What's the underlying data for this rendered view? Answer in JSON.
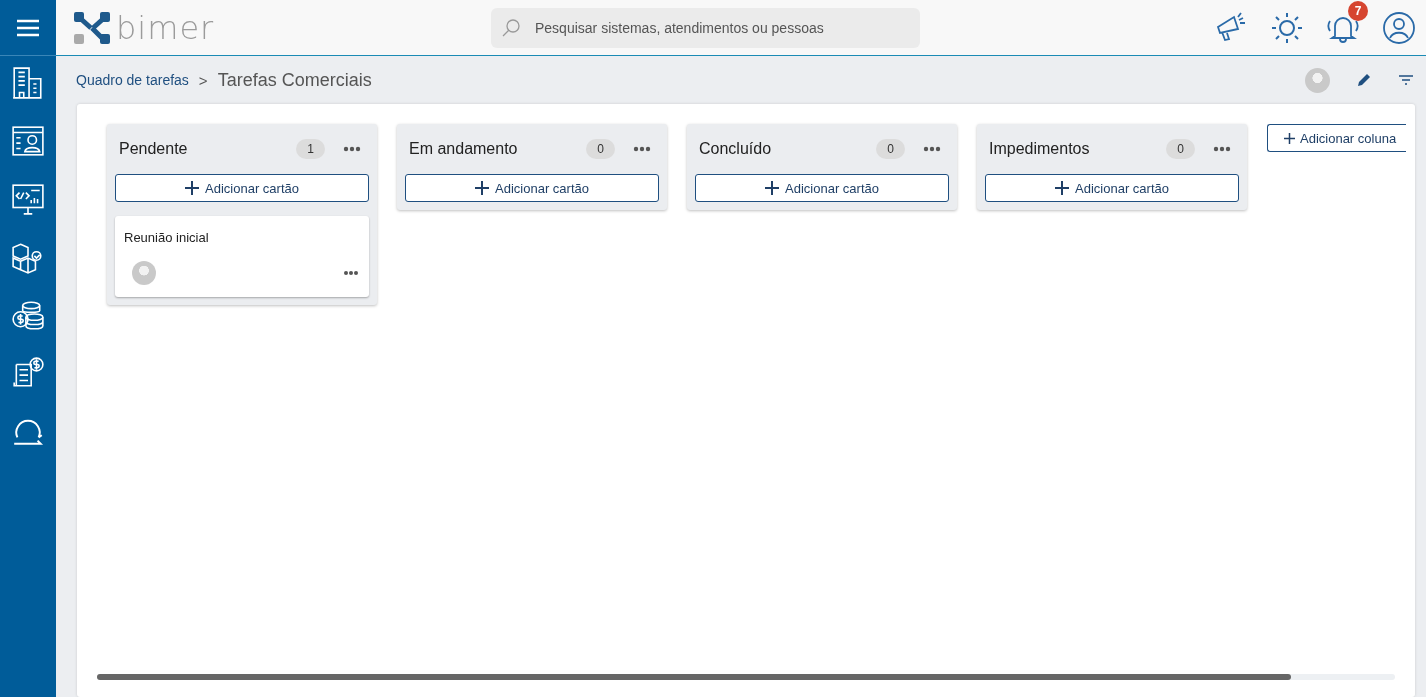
{
  "header": {
    "logo_text": "bimer",
    "search": {
      "placeholder": "Pesquisar sistemas, atendimentos ou pessoas"
    },
    "notifications_count": "7"
  },
  "sidebar": {
    "items": [
      {
        "kind": "buildings"
      },
      {
        "kind": "profile"
      },
      {
        "kind": "code"
      },
      {
        "kind": "cubes"
      },
      {
        "kind": "coins"
      },
      {
        "kind": "invoice"
      },
      {
        "kind": "cycle"
      }
    ]
  },
  "breadcrumb": {
    "parent": "Quadro de tarefas",
    "separator": ">",
    "current": "Tarefas Comerciais"
  },
  "board": {
    "columns": [
      {
        "title": "Pendente",
        "count": "1",
        "add_label": "Adicionar cartão",
        "cards": [
          {
            "title": "Reunião inicial"
          }
        ]
      },
      {
        "title": "Em andamento",
        "count": "0",
        "add_label": "Adicionar cartão"
      },
      {
        "title": "Concluído",
        "count": "0",
        "add_label": "Adicionar cartão"
      },
      {
        "title": "Impedimentos",
        "count": "0",
        "add_label": "Adicionar cartão"
      }
    ],
    "add_column_label": "Adicionar coluna"
  }
}
